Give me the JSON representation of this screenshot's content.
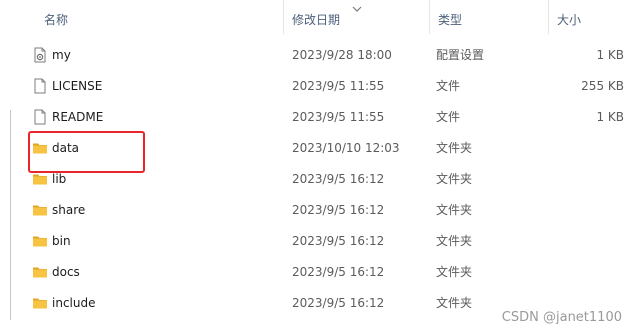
{
  "columns": {
    "name": "名称",
    "date": "修改日期",
    "type": "类型",
    "size": "大小"
  },
  "files": [
    {
      "name": "my",
      "date": "2023/9/28 18:00",
      "type": "配置设置",
      "size": "1 KB",
      "icon": "settings-file-icon"
    },
    {
      "name": "LICENSE",
      "date": "2023/9/5 11:55",
      "type": "文件",
      "size": "255 KB",
      "icon": "file-icon"
    },
    {
      "name": "README",
      "date": "2023/9/5 11:55",
      "type": "文件",
      "size": "1 KB",
      "icon": "file-icon"
    },
    {
      "name": "data",
      "date": "2023/10/10 12:03",
      "type": "文件夹",
      "size": "",
      "icon": "folder-icon"
    },
    {
      "name": "lib",
      "date": "2023/9/5 16:12",
      "type": "文件夹",
      "size": "",
      "icon": "folder-icon"
    },
    {
      "name": "share",
      "date": "2023/9/5 16:12",
      "type": "文件夹",
      "size": "",
      "icon": "folder-icon"
    },
    {
      "name": "bin",
      "date": "2023/9/5 16:12",
      "type": "文件夹",
      "size": "",
      "icon": "folder-icon"
    },
    {
      "name": "docs",
      "date": "2023/9/5 16:12",
      "type": "文件夹",
      "size": "",
      "icon": "folder-icon"
    },
    {
      "name": "include",
      "date": "2023/9/5 16:12",
      "type": "文件夹",
      "size": "",
      "icon": "folder-icon"
    }
  ],
  "watermark": "CSDN @janet1100",
  "colors": {
    "folder": "#f6c342",
    "folder_dark": "#e0a526",
    "highlight": "#e8252a",
    "header_text": "#4c607a"
  }
}
